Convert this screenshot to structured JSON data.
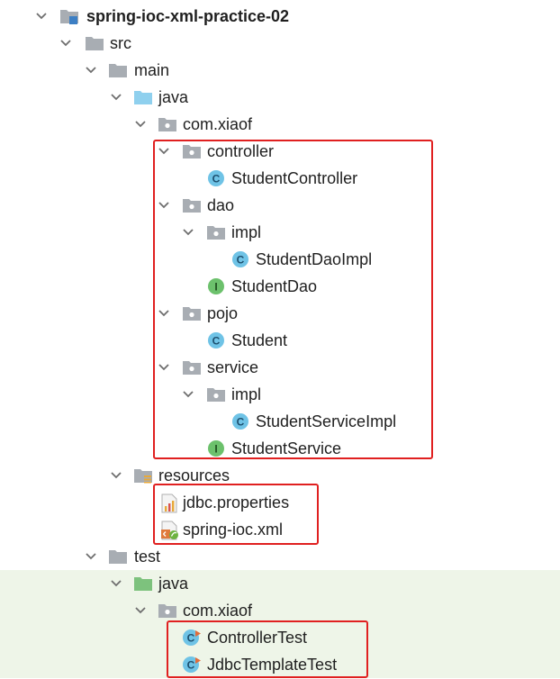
{
  "project": {
    "name": "spring-ioc-xml-practice-02"
  },
  "folders": {
    "src": "src",
    "main": "main",
    "main_java": "java",
    "main_pkg": "com.xiaof",
    "controller": "controller",
    "dao": "dao",
    "dao_impl": "impl",
    "pojo": "pojo",
    "service": "service",
    "service_impl": "impl",
    "resources": "resources",
    "test": "test",
    "test_java": "java",
    "test_pkg": "com.xiaof"
  },
  "files": {
    "student_controller": "StudentController",
    "student_dao_impl": "StudentDaoImpl",
    "student_dao": "StudentDao",
    "student": "Student",
    "student_service_impl": "StudentServiceImpl",
    "student_service": "StudentService",
    "jdbc_properties": "jdbc.properties",
    "spring_ioc_xml": "spring-ioc.xml",
    "controller_test": "ControllerTest",
    "jdbc_template_test": "JdbcTemplateTest"
  },
  "icon_letters": {
    "class": "C",
    "interface": "I"
  },
  "colors": {
    "highlight_box": "#e02020",
    "test_row_bg": "#eef5e8",
    "class_icon": "#6fc3e6",
    "interface_icon": "#6cc16c",
    "source_folder": "#8fd0ee",
    "test_folder": "#7dc27d",
    "folder": "#a8adb3"
  }
}
